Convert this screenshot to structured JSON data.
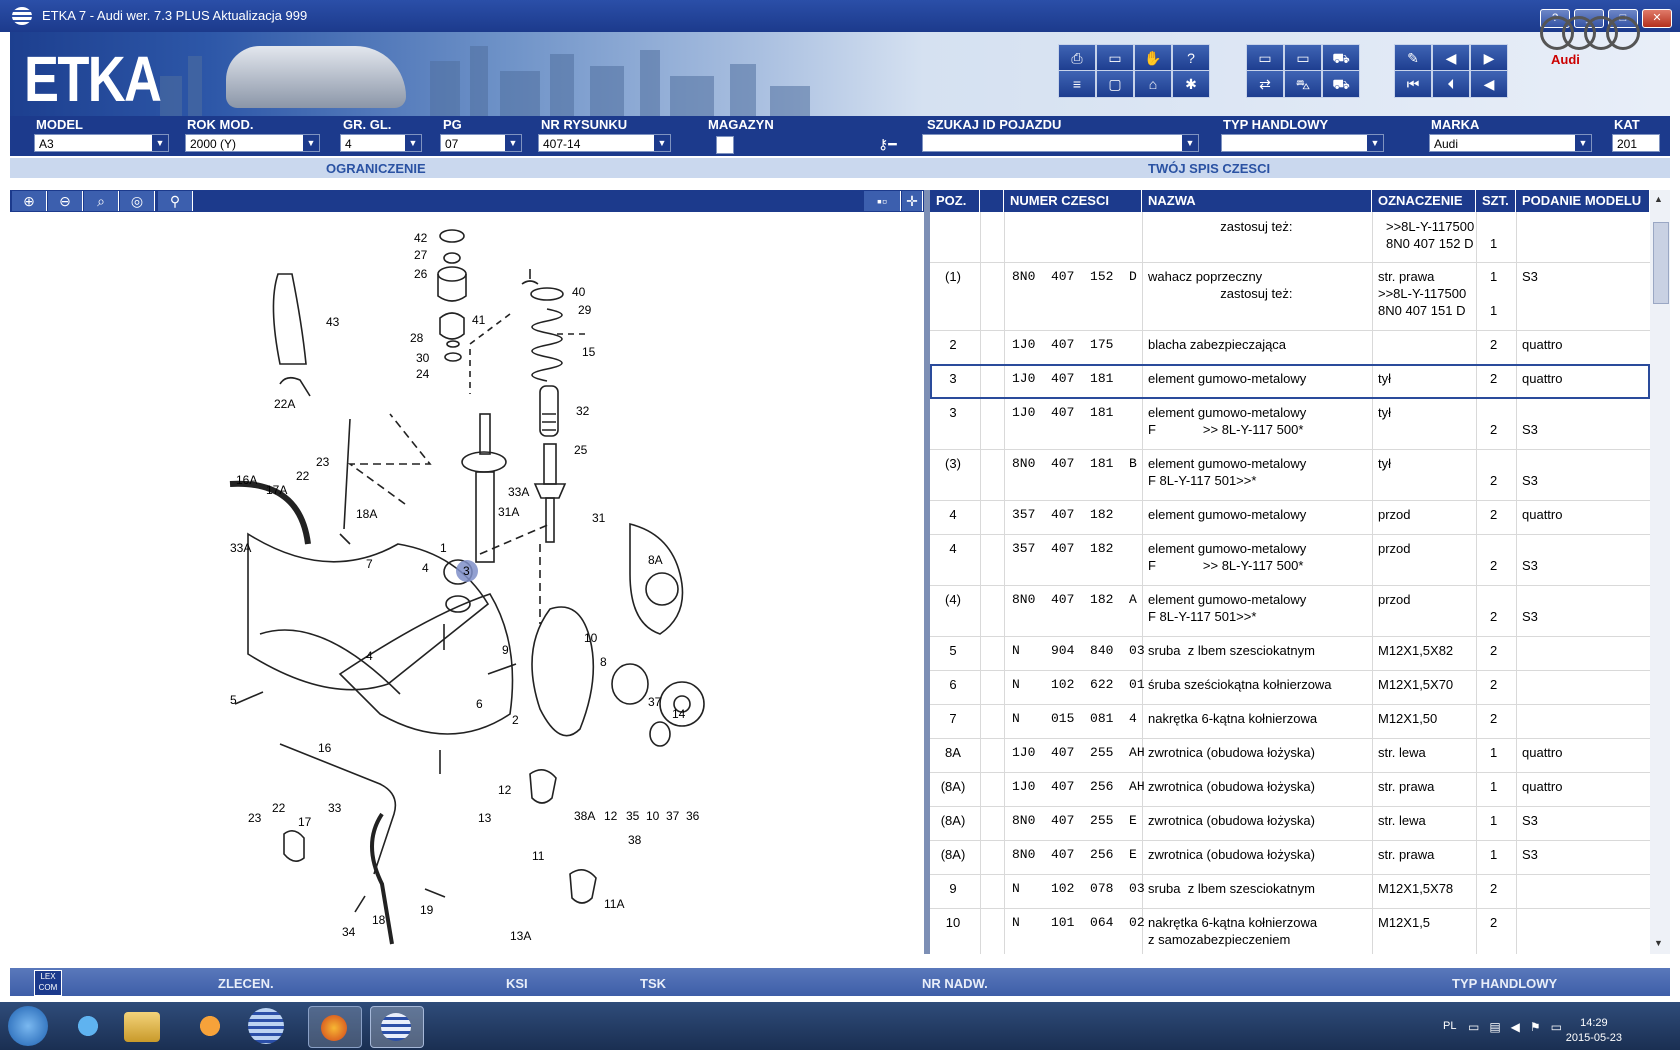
{
  "window": {
    "title": "ETKA 7 - Audi wer. 7.3 PLUS Aktualizacja 999",
    "buttons": {
      "help": "?",
      "minimize": "_",
      "maximize": "□",
      "close": "✕"
    }
  },
  "banner": {
    "logo": "ETKA",
    "brand": "Audi"
  },
  "filters": {
    "model": {
      "label": "MODEL",
      "value": "A3"
    },
    "rok_mod": {
      "label": "ROK MOD.",
      "value": "2000 (Y)"
    },
    "gr_gl": {
      "label": "GR. GL.",
      "value": "4"
    },
    "pg": {
      "label": "PG",
      "value": "07"
    },
    "nr_rysunku": {
      "label": "NR RYSUNKU",
      "value": "407-14"
    },
    "magazyn": {
      "label": "MAGAZYN",
      "value": ""
    },
    "szukaj_id": {
      "label": "SZUKAJ ID POJAZDU",
      "value": ""
    },
    "typ_handlowy": {
      "label": "TYP HANDLOWY",
      "value": ""
    },
    "marka": {
      "label": "MARKA",
      "value": "Audi"
    },
    "kat": {
      "label": "KAT",
      "value": "201"
    }
  },
  "sections": {
    "left": "OGRANICZENIE",
    "right": "TWÓJ SPIS CZESCI"
  },
  "table": {
    "headers": [
      "POZ.",
      "",
      "NUMER CZESCI",
      "NAZWA",
      "OZNACZENIE",
      "SZT.",
      "PODANIE MODELU"
    ],
    "rows": [
      {
        "poz": "",
        "num": "",
        "nazwa": "                    zastosuj też:",
        "ozn": ">>8L-Y-117500\n8N0 407 152 D",
        "szt": "\n1",
        "model": "",
        "h": 50
      },
      {
        "poz": "(1)",
        "num": "8N0  407  152  D",
        "nazwa": "wahacz poprzeczny\n                    zastosuj też:",
        "ozn": "str. prawa\n>>8L-Y-117500\n8N0 407 151 D",
        "szt": "1\n\n1",
        "model": "S3",
        "h": 68
      },
      {
        "poz": "2",
        "num": "1J0  407  175",
        "nazwa": "blacha zabezpieczająca",
        "ozn": "",
        "szt": "2",
        "model": "quattro",
        "h": 34
      },
      {
        "poz": "3",
        "num": "1J0  407  181",
        "nazwa": "element gumowo-metalowy",
        "ozn": "tył",
        "szt": "2",
        "model": "quattro",
        "h": 34,
        "sel": true
      },
      {
        "poz": "3",
        "num": "1J0  407  181",
        "nazwa": "element gumowo-metalowy\nF             >> 8L-Y-117 500*",
        "ozn": "tył",
        "szt": "\n2",
        "model": "\nS3",
        "h": 51
      },
      {
        "poz": "(3)",
        "num": "8N0  407  181  B",
        "nazwa": "element gumowo-metalowy\nF 8L-Y-117 501>>*",
        "ozn": "tył",
        "szt": "\n2",
        "model": "\nS3",
        "h": 51
      },
      {
        "poz": "4",
        "num": "357  407  182",
        "nazwa": "element gumowo-metalowy",
        "ozn": "przod",
        "szt": "2",
        "model": "quattro",
        "h": 34
      },
      {
        "poz": "4",
        "num": "357  407  182",
        "nazwa": "element gumowo-metalowy\nF             >> 8L-Y-117 500*",
        "ozn": "przod",
        "szt": "\n2",
        "model": "\nS3",
        "h": 51
      },
      {
        "poz": "(4)",
        "num": "8N0  407  182  A",
        "nazwa": "element gumowo-metalowy\nF 8L-Y-117 501>>*",
        "ozn": "przod",
        "szt": "\n2",
        "model": "\nS3",
        "h": 51
      },
      {
        "poz": "5",
        "num": "N    904  840  03",
        "nazwa": "sruba  z lbem szesciokatnym",
        "ozn": "M12X1,5X82",
        "szt": "2",
        "model": "",
        "h": 34
      },
      {
        "poz": "6",
        "num": "N    102  622  01",
        "nazwa": "śruba sześciokątna kołnierzowa",
        "ozn": "M12X1,5X70",
        "szt": "2",
        "model": "",
        "h": 34
      },
      {
        "poz": "7",
        "num": "N    015  081  4",
        "nazwa": "nakrętka 6-kątna kołnierzowa",
        "ozn": "M12X1,50",
        "szt": "2",
        "model": "",
        "h": 34
      },
      {
        "poz": "8A",
        "num": "1J0  407  255  AH",
        "nazwa": "zwrotnica (obudowa łożyska)",
        "ozn": "str. lewa",
        "szt": "1",
        "model": "quattro",
        "h": 34
      },
      {
        "poz": "(8A)",
        "num": "1J0  407  256  AH",
        "nazwa": "zwrotnica (obudowa łożyska)",
        "ozn": "str. prawa",
        "szt": "1",
        "model": "quattro",
        "h": 34
      },
      {
        "poz": "(8A)",
        "num": "8N0  407  255  E",
        "nazwa": "zwrotnica (obudowa łożyska)",
        "ozn": "str. lewa",
        "szt": "1",
        "model": "S3",
        "h": 34
      },
      {
        "poz": "(8A)",
        "num": "8N0  407  256  E",
        "nazwa": "zwrotnica (obudowa łożyska)",
        "ozn": "str. prawa",
        "szt": "1",
        "model": "S3",
        "h": 34
      },
      {
        "poz": "9",
        "num": "N    102  078  03",
        "nazwa": "sruba  z lbem szesciokatnym",
        "ozn": "M12X1,5X78",
        "szt": "2",
        "model": "",
        "h": 34
      },
      {
        "poz": "10",
        "num": "N    101  064  02",
        "nazwa": "nakrętka 6-kątna kołnierzowa\nz samozabezpieczeniem",
        "ozn": "M12X1,5",
        "szt": "2",
        "model": "",
        "h": 51
      }
    ]
  },
  "diagram_labels": [
    "42",
    "27",
    "26",
    "41",
    "28",
    "30",
    "24",
    "43",
    "40",
    "29",
    "15",
    "32",
    "25",
    "22A",
    "16A",
    "17A",
    "22",
    "23",
    "18A",
    "33A",
    "33A",
    "31A",
    "31",
    "1",
    "4",
    "3",
    "7",
    "8A",
    "10",
    "8",
    "9",
    "5",
    "6",
    "4",
    "2",
    "14",
    "37",
    "16",
    "12",
    "38A",
    "12",
    "35",
    "10",
    "37",
    "36",
    "38",
    "23",
    "22",
    "17",
    "33",
    "11",
    "13",
    "19",
    "18",
    "34",
    "11A",
    "13A"
  ],
  "bottom": {
    "lexcom": "LEX\nCOM",
    "zlecen": "ZLECEN.",
    "ksi": "KSI",
    "tsk": "TSK",
    "nr_nadw": "NR NADW.",
    "typ_handlowy": "TYP HANDLOWY"
  },
  "taskbar": {
    "lang": "PL",
    "time": "14:29",
    "date": "2015-05-23"
  },
  "colors": {
    "navy": "#1c3a8c",
    "section": "#2a52a3",
    "brand_red": "#cc0000"
  }
}
